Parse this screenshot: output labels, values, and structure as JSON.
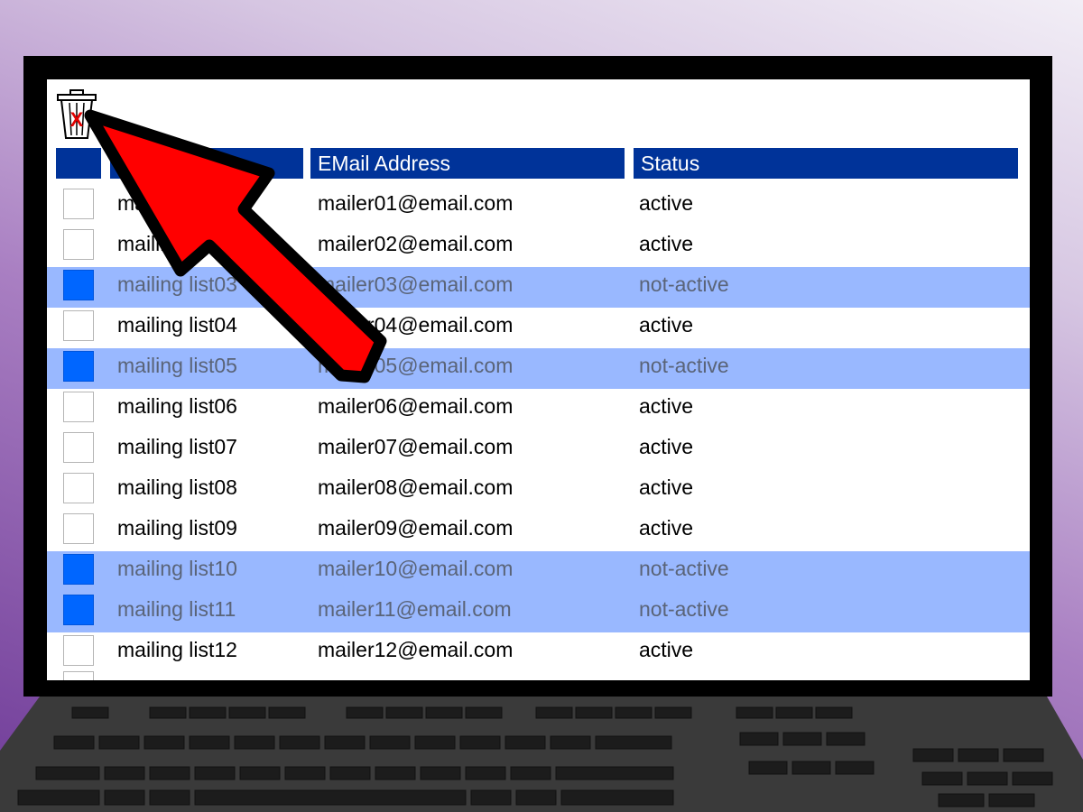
{
  "table": {
    "headers": [
      "",
      "",
      "EMail Address",
      "Status"
    ],
    "rows": [
      {
        "name": "mailing list01",
        "email": "mailer01@email.com",
        "status": "active",
        "checked": false
      },
      {
        "name": "mailing list02",
        "email": "mailer02@email.com",
        "status": "active",
        "checked": false
      },
      {
        "name": "mailing list03",
        "email": "mailer03@email.com",
        "status": "not-active",
        "checked": true
      },
      {
        "name": "mailing list04",
        "email": "mailer04@email.com",
        "status": "active",
        "checked": false
      },
      {
        "name": "mailing list05",
        "email": "mailer05@email.com",
        "status": "not-active",
        "checked": true
      },
      {
        "name": "mailing list06",
        "email": "mailer06@email.com",
        "status": "active",
        "checked": false
      },
      {
        "name": "mailing list07",
        "email": "mailer07@email.com",
        "status": "active",
        "checked": false
      },
      {
        "name": "mailing list08",
        "email": "mailer08@email.com",
        "status": "active",
        "checked": false
      },
      {
        "name": "mailing list09",
        "email": "mailer09@email.com",
        "status": "active",
        "checked": false
      },
      {
        "name": "mailing list10",
        "email": "mailer10@email.com",
        "status": "not-active",
        "checked": true
      },
      {
        "name": "mailing list11",
        "email": "mailer11@email.com",
        "status": "not-active",
        "checked": true
      },
      {
        "name": "mailing list12",
        "email": "mailer12@email.com",
        "status": "active",
        "checked": false
      }
    ]
  },
  "toolbar": {
    "delete_icon": "trash-icon",
    "delete_mark": "X"
  },
  "annotation": {
    "icon": "red-arrow-pointer"
  },
  "colors": {
    "header_bg": "#003399",
    "selected_row_bg": "#99b8ff",
    "checkbox_checked": "#0066ff",
    "arrow": "#ff0000",
    "bezel": "#000000"
  }
}
